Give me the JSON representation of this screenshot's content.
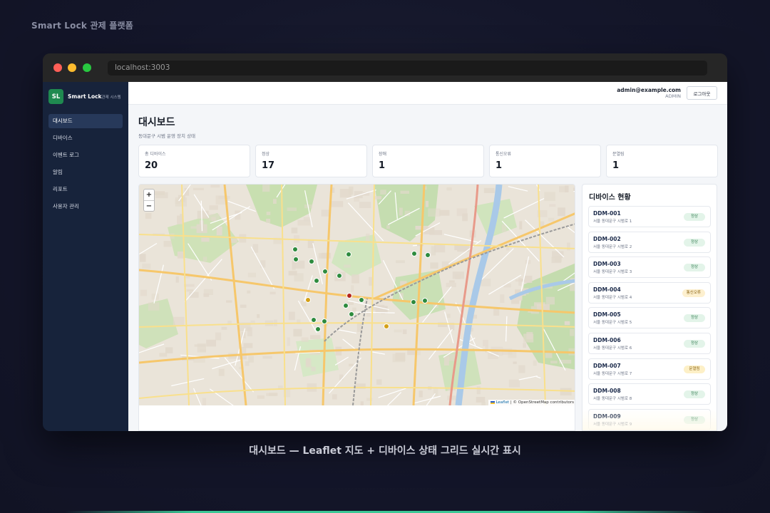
{
  "captions": {
    "top": "Smart Lock 관제 플랫폼",
    "bottom": "대시보드 — Leaflet 지도 + 디바이스 상태 그리드 실시간 표시"
  },
  "browser": {
    "url": "localhost:3003"
  },
  "sidebar": {
    "logo": "SL",
    "brand": "Smart Lock",
    "brand_sub": "관제 시스템",
    "items": [
      {
        "label": "대시보드",
        "active": true
      },
      {
        "label": "디바이스",
        "active": false
      },
      {
        "label": "이벤트 로그",
        "active": false
      },
      {
        "label": "알림",
        "active": false
      },
      {
        "label": "리포트",
        "active": false
      },
      {
        "label": "사용자 관리",
        "active": false
      }
    ]
  },
  "header": {
    "email": "admin@example.com",
    "role": "ADMIN",
    "logout": "로그아웃"
  },
  "page": {
    "title": "대시보드",
    "subtitle": "동대문구 시범 운영 장치 상태"
  },
  "stats": [
    {
      "label": "총 디바이스",
      "value": "20"
    },
    {
      "label": "정상",
      "value": "17"
    },
    {
      "label": "장애",
      "value": "1"
    },
    {
      "label": "통신오류",
      "value": "1"
    },
    {
      "label": "문열림",
      "value": "1"
    }
  ],
  "map": {
    "zoom_in": "+",
    "zoom_out": "−",
    "attribution_leaflet": "Leaflet",
    "attribution_rest": " | © OpenStreetMap contributors",
    "marker_colors": {
      "normal": "#2e8b3e",
      "fault": "#b3261e",
      "comm": "#d4a017"
    }
  },
  "devices": {
    "title": "디바이스 현황",
    "items": [
      {
        "id": "DDM-001",
        "address": "서울 동대문구 시범로 1",
        "status": "정상",
        "kind": "normal"
      },
      {
        "id": "DDM-002",
        "address": "서울 동대문구 시범로 2",
        "status": "정상",
        "kind": "normal"
      },
      {
        "id": "DDM-003",
        "address": "서울 동대문구 시범로 3",
        "status": "정상",
        "kind": "normal"
      },
      {
        "id": "DDM-004",
        "address": "서울 동대문구 시범로 4",
        "status": "통신오류",
        "kind": "comm"
      },
      {
        "id": "DDM-005",
        "address": "서울 동대문구 시범로 5",
        "status": "정상",
        "kind": "normal"
      },
      {
        "id": "DDM-006",
        "address": "서울 동대문구 시범로 6",
        "status": "정상",
        "kind": "normal"
      },
      {
        "id": "DDM-007",
        "address": "서울 동대문구 시범로 7",
        "status": "문열림",
        "kind": "open"
      },
      {
        "id": "DDM-008",
        "address": "서울 동대문구 시범로 8",
        "status": "정상",
        "kind": "normal"
      },
      {
        "id": "DDM-009",
        "address": "서울 동대문구 시범로 9",
        "status": "정상",
        "kind": "normal"
      }
    ]
  }
}
